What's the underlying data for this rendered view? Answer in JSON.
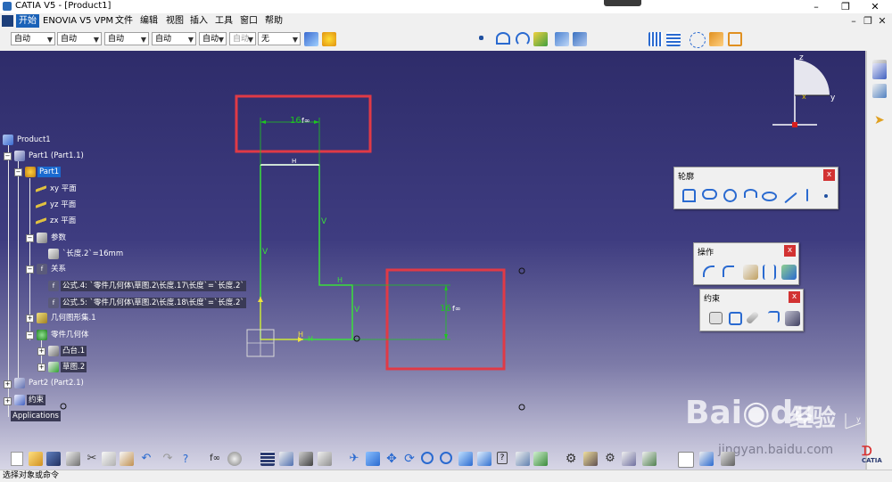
{
  "window": {
    "title": "CATIA V5 - [Product1]",
    "controls": [
      "–",
      "❐",
      "✕"
    ]
  },
  "menubar": {
    "items": [
      {
        "label": "开始",
        "active": true
      },
      {
        "label": "ENOVIA V5 VPM"
      },
      {
        "label": "文件"
      },
      {
        "label": "编辑"
      },
      {
        "label": "视图"
      },
      {
        "label": "插入"
      },
      {
        "label": "工具"
      },
      {
        "label": "窗口"
      },
      {
        "label": "帮助"
      }
    ],
    "doc_controls": [
      "–",
      "❐",
      "✕"
    ]
  },
  "propbar": {
    "combos": [
      {
        "value": "自动"
      },
      {
        "value": "自动"
      },
      {
        "value": "自动"
      },
      {
        "value": "自动"
      },
      {
        "value": "自动"
      },
      {
        "value": "自动",
        "disabled": true
      },
      {
        "value": "无"
      }
    ]
  },
  "tree": {
    "root": "Product1",
    "part1": "Part1 (Part1.1)",
    "part1_body": "Part1",
    "xy_plane": "xy 平面",
    "yz_plane": "yz 平面",
    "zx_plane": "zx 平面",
    "parameters": "参数",
    "length_param": "`长度.2`=16mm",
    "relations": "关系",
    "formula4": "公式.4: `零件几何体\\草图.2\\长度.17\\长度`=`长度.2`",
    "formula5": "公式.5: `零件几何体\\草图.2\\长度.18\\长度`=`长度.2`",
    "geom_set": "几何图形集.1",
    "part_body": "零件几何体",
    "pad": "凸台.1",
    "sketch": "草图.2",
    "part2": "Part2 (Part2.1)",
    "constraints": "约束",
    "applications": "Applications"
  },
  "sketch": {
    "dim_top": "16",
    "dim_right": "16",
    "constraint_h": "H",
    "constraint_v": "V"
  },
  "compass": {
    "x": "x",
    "y": "y",
    "z": "z"
  },
  "axis_corner": {
    "y": "y",
    "z": "z",
    "x": "x"
  },
  "panels": {
    "profile": {
      "title": "轮廓",
      "close": "x"
    },
    "operation": {
      "title": "操作",
      "close": "x"
    },
    "constraint": {
      "title": "约束",
      "close": "x"
    }
  },
  "statusbar": {
    "text": "选择对象或命令"
  },
  "watermark": {
    "brand": "Bai",
    "brand2": "du",
    "cn": "经验",
    "url": "jingyan.baidu.com"
  },
  "catia_logo": "CATIA",
  "colors": {
    "sketch_line": "#3adf3a",
    "highlight_box": "#e03a46",
    "dim_line": "#1ec81e",
    "selected": "#1a6ad0"
  }
}
